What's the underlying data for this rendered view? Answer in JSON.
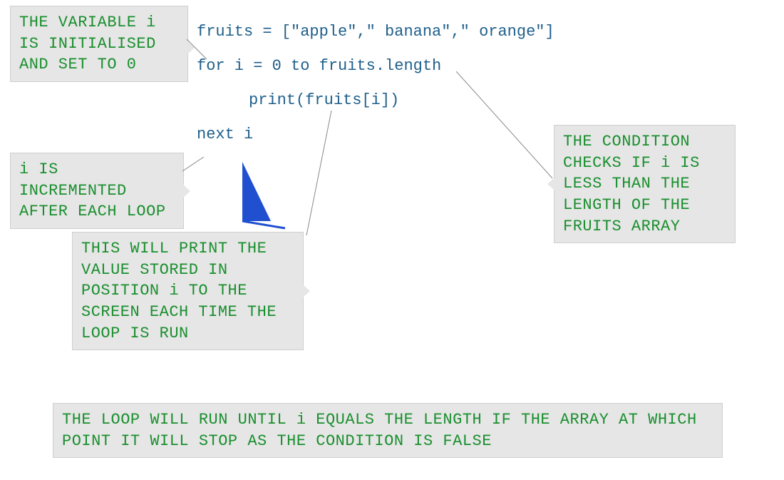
{
  "code": {
    "line1": "fruits = [\"apple\",\" banana\",\" orange\"]",
    "line2": "for i = 0 to fruits.length",
    "line3": "print(fruits[i])",
    "line4": "next i"
  },
  "callouts": {
    "init": "THE VARIABLE i IS INITIALISED AND SET TO 0",
    "increment": "i IS INCREMENTED AFTER EACH LOOP",
    "print": "THIS WILL PRINT THE VALUE STORED IN POSITION i TO THE SCREEN EACH TIME THE LOOP IS RUN",
    "condition": "THE CONDITION CHECKS IF i IS LESS THAN THE LENGTH OF THE FRUITS ARRAY",
    "summary": "THE LOOP WILL RUN UNTIL i EQUALS THE LENGTH IF THE ARRAY AT WHICH POINT IT WILL STOP AS THE CONDITION IS FALSE"
  },
  "colors": {
    "code": "#1f5f8b",
    "callout_text": "#1a8f2e",
    "callout_bg": "#e6e6e6",
    "arrow": "#2050d0"
  }
}
